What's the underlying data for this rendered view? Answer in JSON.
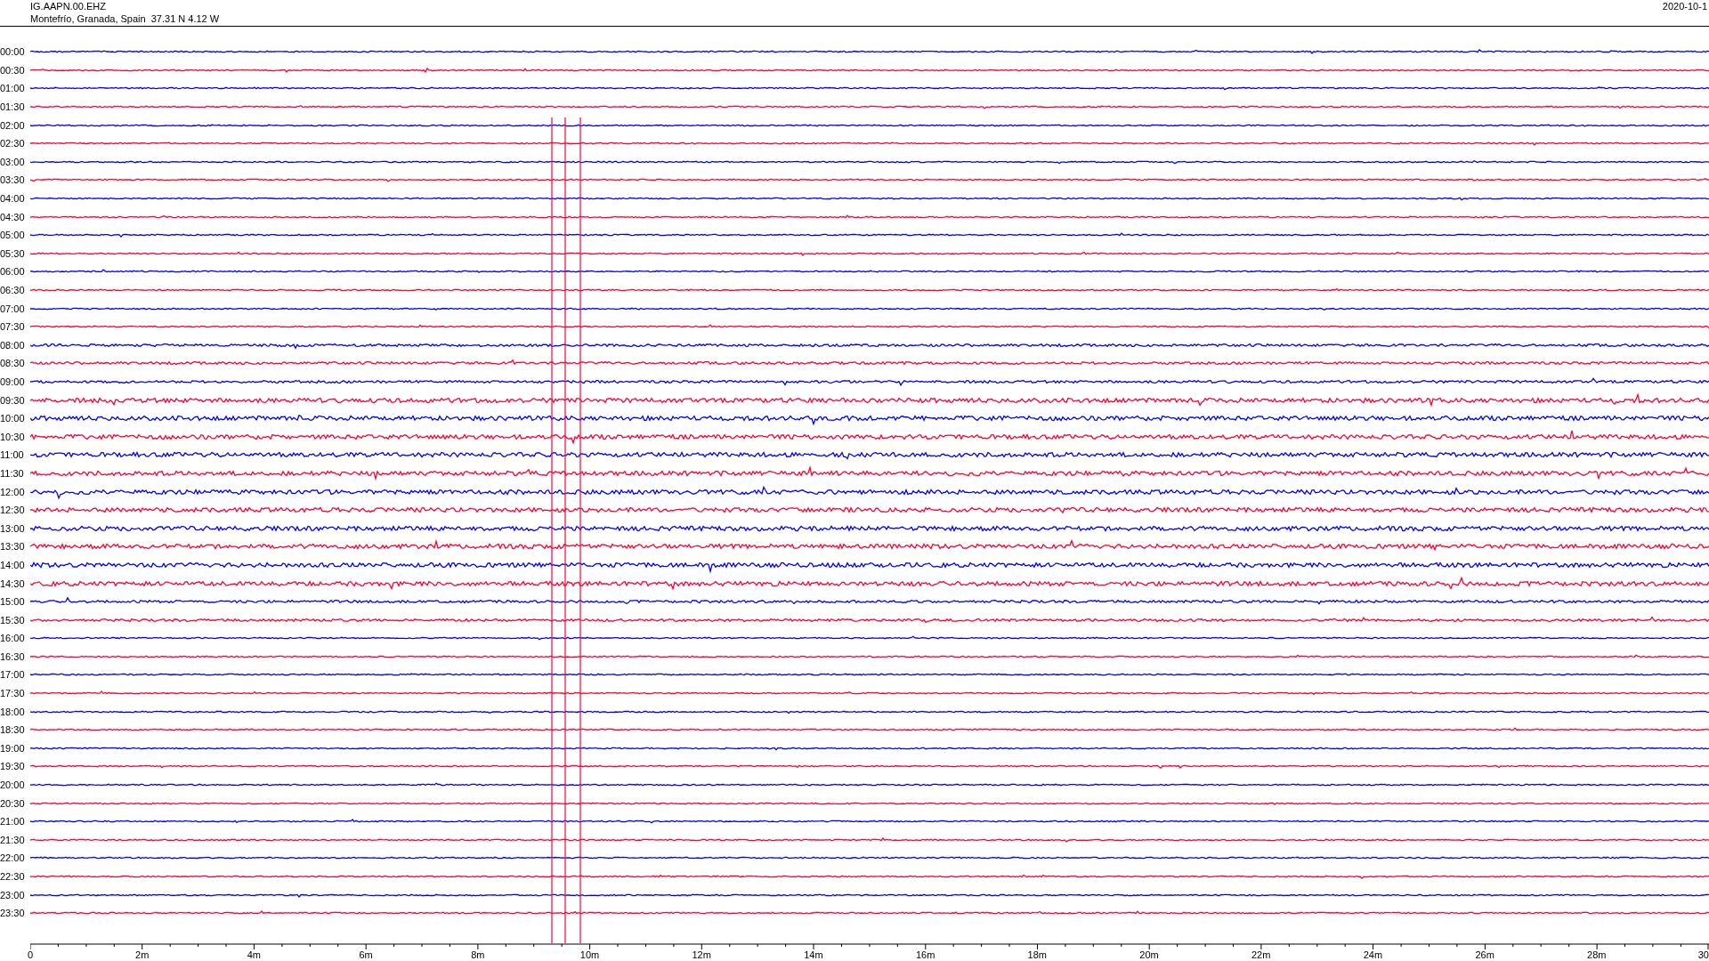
{
  "header": {
    "station": "IG.AAPN.00.EHZ",
    "location": "Montefrío, Granada, Spain  37.31 N 4.12 W",
    "date": "2020-10-1"
  },
  "traces": [
    {
      "time": "00:00",
      "color": "#0000ff"
    },
    {
      "time": "00:30",
      "color": "#ff0033"
    },
    {
      "time": "01:00",
      "color": "#0000ff"
    },
    {
      "time": "01:30",
      "color": "#ff0033"
    },
    {
      "time": "02:00",
      "color": "#0000ff"
    },
    {
      "time": "02:30",
      "color": "#ff0033"
    },
    {
      "time": "03:00",
      "color": "#0000ff"
    },
    {
      "time": "03:30",
      "color": "#ff0033"
    },
    {
      "time": "04:00",
      "color": "#0000ff"
    },
    {
      "time": "04:30",
      "color": "#ff0033"
    },
    {
      "time": "05:00",
      "color": "#0000ff"
    },
    {
      "time": "05:30",
      "color": "#ff0033"
    },
    {
      "time": "06:00",
      "color": "#0000ff"
    },
    {
      "time": "06:30",
      "color": "#ff0033"
    },
    {
      "time": "07:00",
      "color": "#0000ff"
    },
    {
      "time": "07:30",
      "color": "#ff0033"
    },
    {
      "time": "08:00",
      "color": "#0000ff"
    },
    {
      "time": "08:30",
      "color": "#ff0033"
    },
    {
      "time": "09:00",
      "color": "#0000ff"
    },
    {
      "time": "09:30",
      "color": "#ff0033"
    },
    {
      "time": "10:00",
      "color": "#0000ff"
    },
    {
      "time": "10:30",
      "color": "#ff0033"
    },
    {
      "time": "11:00",
      "color": "#0000ff"
    },
    {
      "time": "11:30",
      "color": "#ff0033"
    },
    {
      "time": "12:00",
      "color": "#0000ff"
    },
    {
      "time": "12:30",
      "color": "#ff0033"
    },
    {
      "time": "13:00",
      "color": "#0000ff"
    },
    {
      "time": "13:30",
      "color": "#ff0033"
    },
    {
      "time": "14:00",
      "color": "#0000ff"
    },
    {
      "time": "14:30",
      "color": "#ff0033"
    },
    {
      "time": "15:00",
      "color": "#0000ff"
    },
    {
      "time": "15:30",
      "color": "#ff0033"
    },
    {
      "time": "16:00",
      "color": "#0000ff"
    },
    {
      "time": "16:30",
      "color": "#ff0033"
    },
    {
      "time": "17:00",
      "color": "#0000ff"
    },
    {
      "time": "17:30",
      "color": "#ff0033"
    },
    {
      "time": "18:00",
      "color": "#0000ff"
    },
    {
      "time": "18:30",
      "color": "#ff0033"
    },
    {
      "time": "19:00",
      "color": "#0000ff"
    },
    {
      "time": "19:30",
      "color": "#ff0033"
    },
    {
      "time": "20:00",
      "color": "#0000ff"
    },
    {
      "time": "20:30",
      "color": "#ff0033"
    },
    {
      "time": "21:00",
      "color": "#0000ff"
    },
    {
      "time": "21:30",
      "color": "#ff0033"
    },
    {
      "time": "22:00",
      "color": "#0000ff"
    },
    {
      "time": "22:30",
      "color": "#ff0033"
    },
    {
      "time": "23:00",
      "color": "#0000ff"
    },
    {
      "time": "23:30",
      "color": "#ff0033"
    }
  ],
  "x_axis": {
    "labels": [
      "0",
      "2m",
      "4m",
      "6m",
      "8m",
      "10m",
      "12m",
      "14m",
      "16m",
      "18m",
      "20m",
      "22m",
      "24m",
      "26m",
      "28m",
      "30"
    ]
  }
}
